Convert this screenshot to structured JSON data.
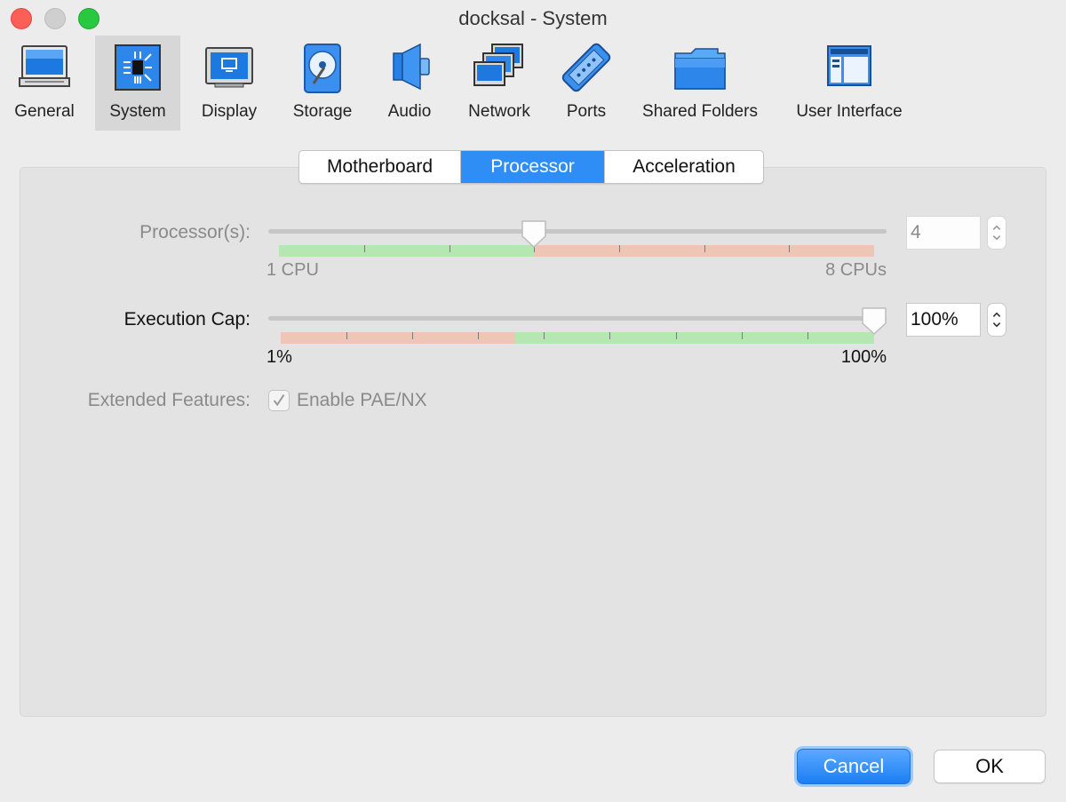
{
  "window": {
    "title": "docksal - System"
  },
  "toolbar": {
    "items": [
      {
        "label": "General",
        "icon": "general-icon"
      },
      {
        "label": "System",
        "icon": "system-icon",
        "selected": true
      },
      {
        "label": "Display",
        "icon": "display-icon"
      },
      {
        "label": "Storage",
        "icon": "storage-icon"
      },
      {
        "label": "Audio",
        "icon": "audio-icon"
      },
      {
        "label": "Network",
        "icon": "network-icon"
      },
      {
        "label": "Ports",
        "icon": "ports-icon"
      },
      {
        "label": "Shared Folders",
        "icon": "shared-folders-icon"
      },
      {
        "label": "User Interface",
        "icon": "user-interface-icon"
      }
    ]
  },
  "tabs": [
    {
      "label": "Motherboard"
    },
    {
      "label": "Processor",
      "active": true
    },
    {
      "label": "Acceleration"
    }
  ],
  "processor": {
    "label": "Processor(s):",
    "value": "4",
    "min_label": "1 CPU",
    "max_label": "8 CPUs",
    "min": 1,
    "max": 8,
    "current": 4,
    "enabled": false
  },
  "execution_cap": {
    "label": "Execution Cap:",
    "value": "100%",
    "min_label": "1%",
    "max_label": "100%",
    "min": 1,
    "max": 100,
    "current": 100,
    "enabled": true
  },
  "extended": {
    "label": "Extended Features:",
    "checkbox_label": "Enable PAE/NX",
    "checked": true,
    "enabled": false
  },
  "buttons": {
    "cancel": "Cancel",
    "ok": "OK"
  },
  "colors": {
    "accent": "#2f8ef6",
    "scale_green": "#b5e8b0",
    "scale_red": "#efc6b6",
    "close": "#fc5f57",
    "maximize": "#28c840"
  }
}
